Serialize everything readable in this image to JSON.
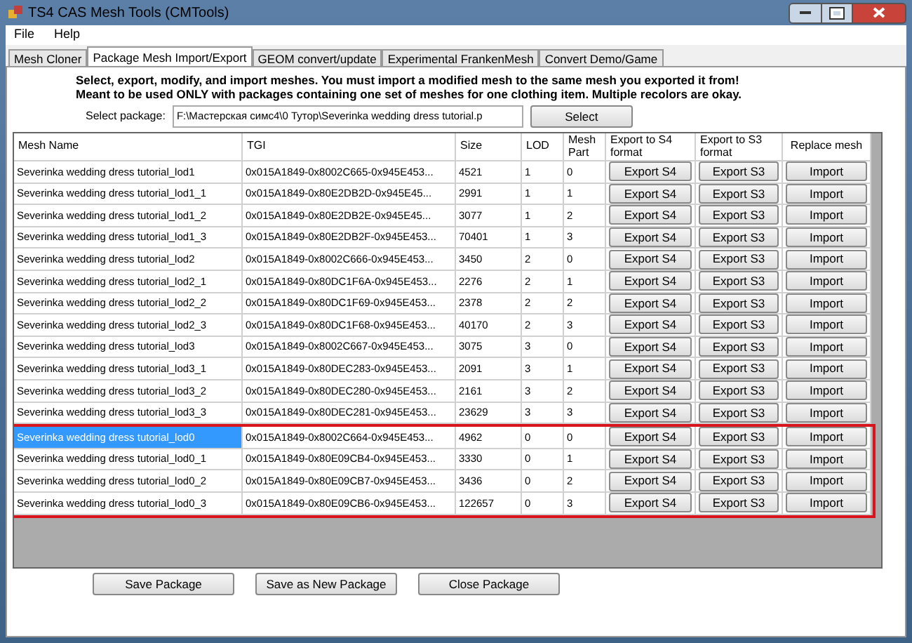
{
  "window": {
    "title": "TS4 CAS Mesh Tools (CMTools)"
  },
  "menu": [
    "File",
    "Help"
  ],
  "tabs": [
    {
      "label": "Mesh Cloner",
      "selected": false
    },
    {
      "label": "Package Mesh Import/Export",
      "selected": true
    },
    {
      "label": "GEOM convert/update",
      "selected": false
    },
    {
      "label": "Experimental FrankenMesh",
      "selected": false
    },
    {
      "label": "Convert Demo/Game",
      "selected": false
    }
  ],
  "instructions": [
    "Select, export, modify, and import meshes. You must import a modified mesh to the same mesh you exported it from!",
    "Meant to be used ONLY with packages containing one set of meshes for one clothing item. Multiple recolors are okay."
  ],
  "package": {
    "label": "Select package:",
    "value": "F:\\Мастерская симс4\\0 Тутор\\Severinka wedding dress tutorial.p",
    "button": "Select"
  },
  "table": {
    "columns": [
      "Mesh Name",
      "TGI",
      "Size",
      "LOD",
      "Mesh Part",
      "Export to S4 format",
      "Export to S3 format",
      "Replace mesh"
    ],
    "rows": [
      {
        "name": "Severinka wedding dress tutorial_lod1",
        "tgi": "0x015A1849-0x8002C665-0x945E453...",
        "size": "4521",
        "lod": "1",
        "part": "0",
        "s4": "Export S4",
        "s3": "Export S3",
        "replace": "Import",
        "selected": false,
        "highlighted": false
      },
      {
        "name": "Severinka wedding dress tutorial_lod1_1",
        "tgi": "0x015A1849-0x80E2DB2D-0x945E45...",
        "size": "2991",
        "lod": "1",
        "part": "1",
        "s4": "Export S4",
        "s3": "Export S3",
        "replace": "Import",
        "selected": false,
        "highlighted": false
      },
      {
        "name": "Severinka wedding dress tutorial_lod1_2",
        "tgi": "0x015A1849-0x80E2DB2E-0x945E45...",
        "size": "3077",
        "lod": "1",
        "part": "2",
        "s4": "Export S4",
        "s3": "Export S3",
        "replace": "Import",
        "selected": false,
        "highlighted": false
      },
      {
        "name": "Severinka wedding dress tutorial_lod1_3",
        "tgi": "0x015A1849-0x80E2DB2F-0x945E453...",
        "size": "70401",
        "lod": "1",
        "part": "3",
        "s4": "Export S4",
        "s3": "Export S3",
        "replace": "Import",
        "selected": false,
        "highlighted": false
      },
      {
        "name": "Severinka wedding dress tutorial_lod2",
        "tgi": "0x015A1849-0x8002C666-0x945E453...",
        "size": "3450",
        "lod": "2",
        "part": "0",
        "s4": "Export S4",
        "s3": "Export S3",
        "replace": "Import",
        "selected": false,
        "highlighted": false
      },
      {
        "name": "Severinka wedding dress tutorial_lod2_1",
        "tgi": "0x015A1849-0x80DC1F6A-0x945E453...",
        "size": "2276",
        "lod": "2",
        "part": "1",
        "s4": "Export S4",
        "s3": "Export S3",
        "replace": "Import",
        "selected": false,
        "highlighted": false
      },
      {
        "name": "Severinka wedding dress tutorial_lod2_2",
        "tgi": "0x015A1849-0x80DC1F69-0x945E453...",
        "size": "2378",
        "lod": "2",
        "part": "2",
        "s4": "Export S4",
        "s3": "Export S3",
        "replace": "Import",
        "selected": false,
        "highlighted": false
      },
      {
        "name": "Severinka wedding dress tutorial_lod2_3",
        "tgi": "0x015A1849-0x80DC1F68-0x945E453...",
        "size": "40170",
        "lod": "2",
        "part": "3",
        "s4": "Export S4",
        "s3": "Export S3",
        "replace": "Import",
        "selected": false,
        "highlighted": false
      },
      {
        "name": "Severinka wedding dress tutorial_lod3",
        "tgi": "0x015A1849-0x8002C667-0x945E453...",
        "size": "3075",
        "lod": "3",
        "part": "0",
        "s4": "Export S4",
        "s3": "Export S3",
        "replace": "Import",
        "selected": false,
        "highlighted": false
      },
      {
        "name": "Severinka wedding dress tutorial_lod3_1",
        "tgi": "0x015A1849-0x80DEC283-0x945E453...",
        "size": "2091",
        "lod": "3",
        "part": "1",
        "s4": "Export S4",
        "s3": "Export S3",
        "replace": "Import",
        "selected": false,
        "highlighted": false
      },
      {
        "name": "Severinka wedding dress tutorial_lod3_2",
        "tgi": "0x015A1849-0x80DEC280-0x945E453...",
        "size": "2161",
        "lod": "3",
        "part": "2",
        "s4": "Export S4",
        "s3": "Export S3",
        "replace": "Import",
        "selected": false,
        "highlighted": false
      },
      {
        "name": "Severinka wedding dress tutorial_lod3_3",
        "tgi": "0x015A1849-0x80DEC281-0x945E453...",
        "size": "23629",
        "lod": "3",
        "part": "3",
        "s4": "Export S4",
        "s3": "Export S3",
        "replace": "Import",
        "selected": false,
        "highlighted": false
      },
      {
        "name": "Severinka wedding dress tutorial_lod0",
        "tgi": "0x015A1849-0x8002C664-0x945E453...",
        "size": "4962",
        "lod": "0",
        "part": "0",
        "s4": "Export S4",
        "s3": "Export S3",
        "replace": "Import",
        "selected": true,
        "highlighted": true
      },
      {
        "name": "Severinka wedding dress tutorial_lod0_1",
        "tgi": "0x015A1849-0x80E09CB4-0x945E453...",
        "size": "3330",
        "lod": "0",
        "part": "1",
        "s4": "Export S4",
        "s3": "Export S3",
        "replace": "Import",
        "selected": false,
        "highlighted": true
      },
      {
        "name": "Severinka wedding dress tutorial_lod0_2",
        "tgi": "0x015A1849-0x80E09CB7-0x945E453...",
        "size": "3436",
        "lod": "0",
        "part": "2",
        "s4": "Export S4",
        "s3": "Export S3",
        "replace": "Import",
        "selected": false,
        "highlighted": true
      },
      {
        "name": "Severinka wedding dress tutorial_lod0_3",
        "tgi": "0x015A1849-0x80E09CB6-0x945E453...",
        "size": "122657",
        "lod": "0",
        "part": "3",
        "s4": "Export S4",
        "s3": "Export S3",
        "replace": "Import",
        "selected": false,
        "highlighted": true
      }
    ]
  },
  "buttons": [
    "Save Package",
    "Save as New Package",
    "Close Package"
  ]
}
